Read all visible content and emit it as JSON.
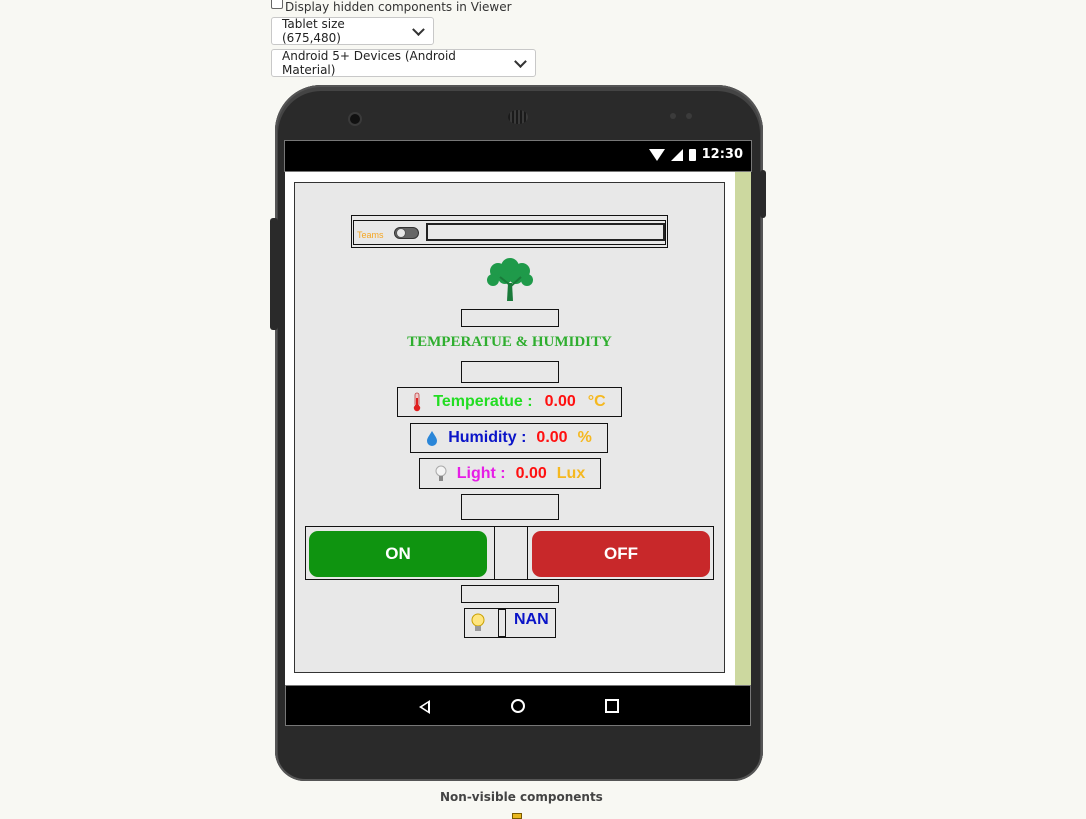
{
  "viewer": {
    "hidden_components_label": "Display hidden components in Viewer",
    "size_select": "Tablet size (675,480)",
    "theme_select": "Android 5+ Devices (Android Material)"
  },
  "statusbar": {
    "time": "12:30"
  },
  "app": {
    "teams_label": "Teams",
    "title": "TEMPERATUE & HUMIDITY",
    "temperature": {
      "label": "Temperatue :",
      "value": "0.00",
      "unit": "°C"
    },
    "humidity": {
      "label": "Humidity :",
      "value": "0.00",
      "unit": "%"
    },
    "light": {
      "label": "Light :",
      "value": "0.00",
      "unit": "Lux"
    },
    "on_button": "ON",
    "off_button": "OFF",
    "status_value": "NAN"
  },
  "footer": {
    "nonvisible_label": "Non-visible components"
  },
  "colors": {
    "on": "#0f9410",
    "off": "#c8282a",
    "title": "#2fae2f",
    "value": "#ff1010",
    "unit": "#f5b820"
  },
  "icons": [
    "thermometer-icon",
    "water-drop-icon",
    "light-bulb-icon",
    "tree-logo-icon"
  ]
}
